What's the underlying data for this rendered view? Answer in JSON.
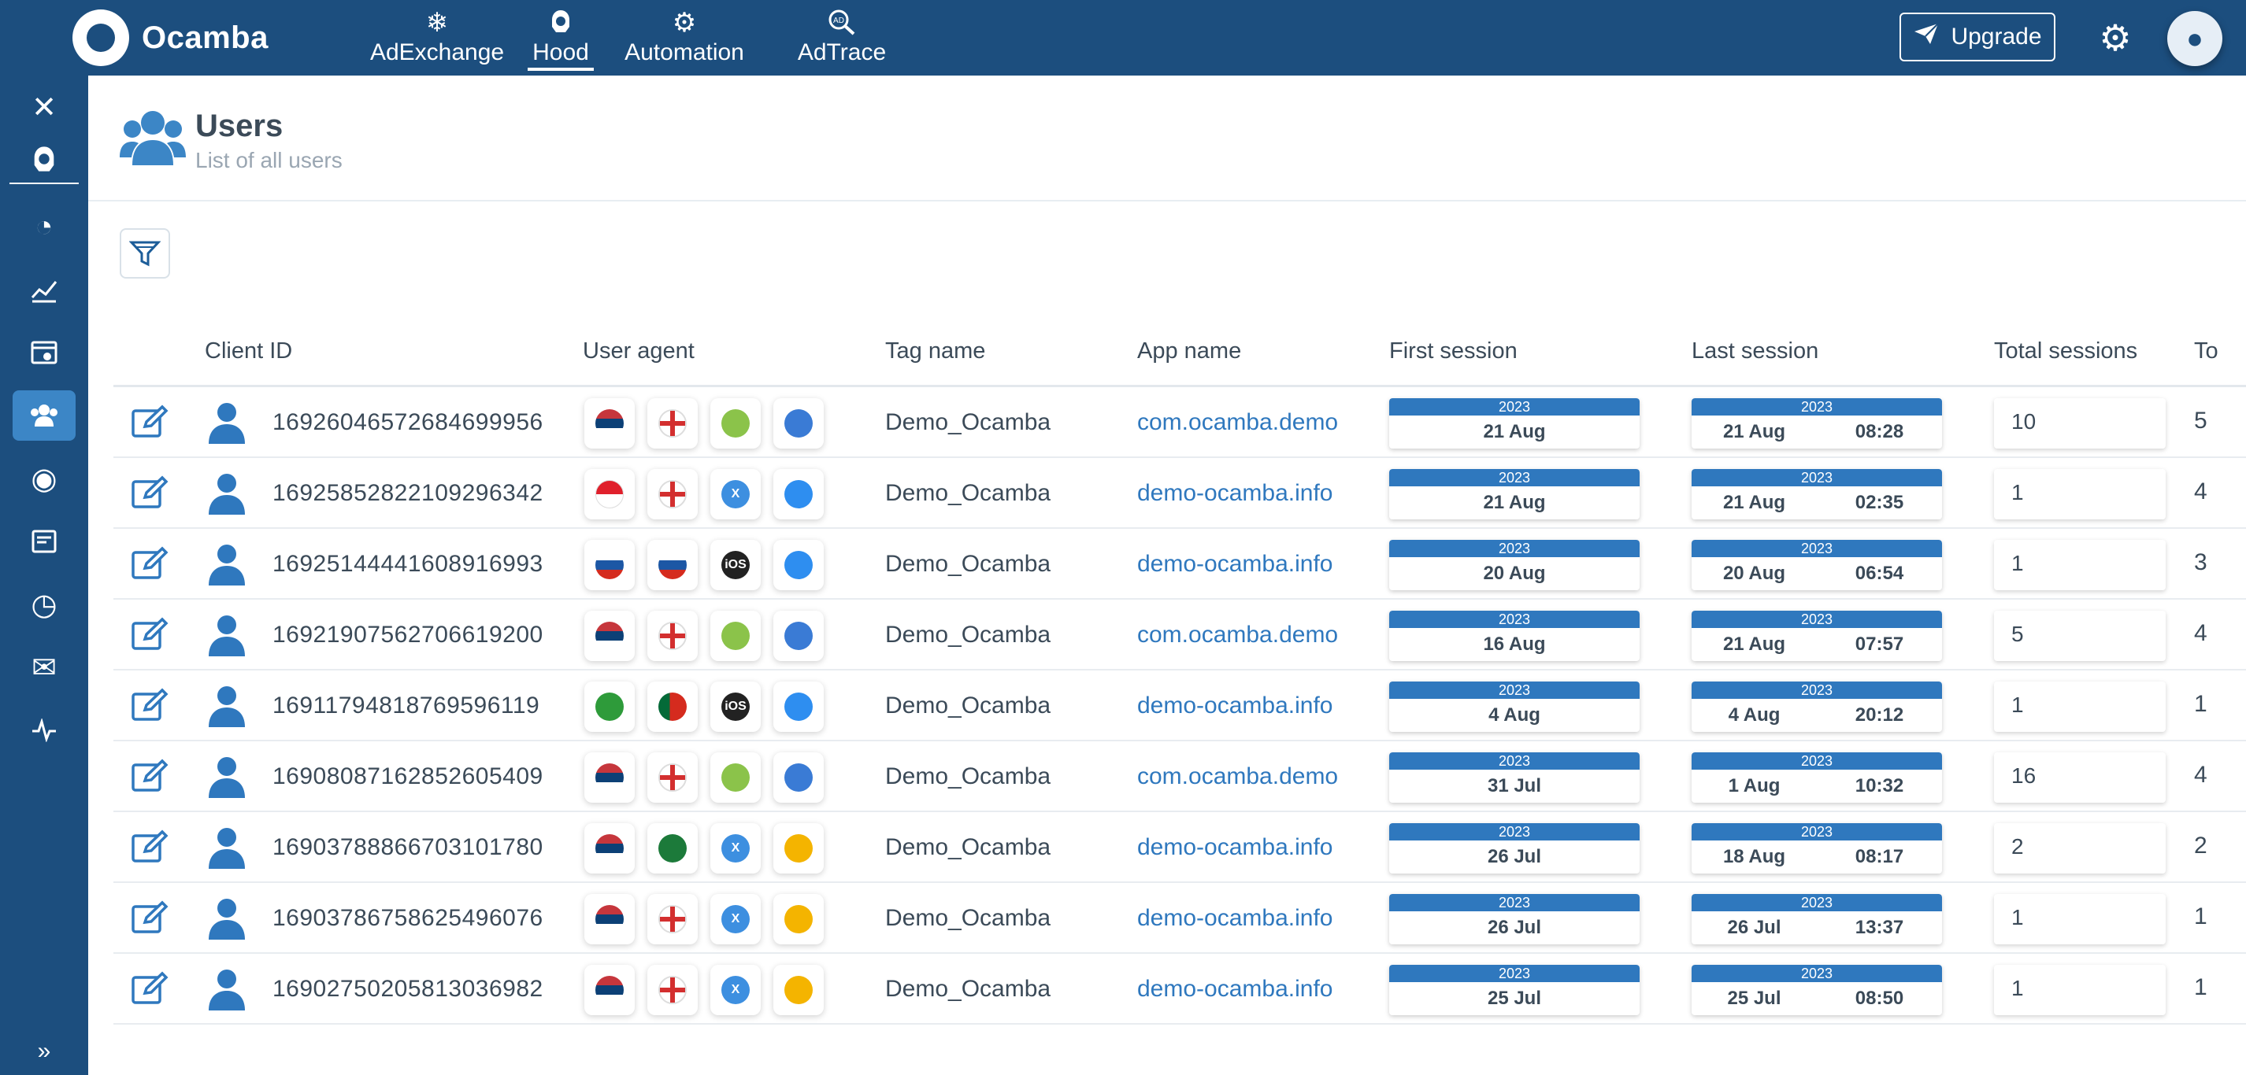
{
  "topbar": {
    "brand": "Ocamba",
    "nav": [
      {
        "label": "AdExchange",
        "icon": "snowflake-icon"
      },
      {
        "label": "Hood",
        "icon": "hood-icon"
      },
      {
        "label": "Automation",
        "icon": "automation-icon"
      },
      {
        "label": "AdTrace",
        "icon": "adtrace-icon"
      }
    ],
    "upgrade_label": "Upgrade"
  },
  "page": {
    "title": "Users",
    "subtitle": "List of all users"
  },
  "table": {
    "columns": [
      "Client ID",
      "User agent",
      "Tag name",
      "App name",
      "First session",
      "Last session",
      "Total sessions",
      "To"
    ],
    "rows": [
      {
        "client_id": "1692604657268469995​6",
        "ua": [
          "rs",
          "en",
          "android",
          "web"
        ],
        "tag": "Demo_Ocamba",
        "app": "com.ocamba.demo",
        "first_year": "2023",
        "first_date": "21 Aug",
        "last_year": "2023",
        "last_date": "21 Aug",
        "last_time": "08:28",
        "total": "10",
        "to": "5"
      },
      {
        "client_id": "16925852822109296342",
        "ua": [
          "id",
          "en",
          "ios-x",
          "safari"
        ],
        "tag": "Demo_Ocamba",
        "app": "demo-ocamba.info",
        "first_year": "2023",
        "first_date": "21 Aug",
        "last_year": "2023",
        "last_date": "21 Aug",
        "last_time": "02:35",
        "total": "1",
        "to": "4"
      },
      {
        "client_id": "16925144441608916993",
        "ua": [
          "ru",
          "ru",
          "ios",
          "safari"
        ],
        "tag": "Demo_Ocamba",
        "app": "demo-ocamba.info",
        "first_year": "2023",
        "first_date": "20 Aug",
        "last_year": "2023",
        "last_date": "20 Aug",
        "last_time": "06:54",
        "total": "1",
        "to": "3"
      },
      {
        "client_id": "16921907562706619200",
        "ua": [
          "rs",
          "en",
          "android",
          "web"
        ],
        "tag": "Demo_Ocamba",
        "app": "com.ocamba.demo",
        "first_year": "2023",
        "first_date": "16 Aug",
        "last_year": "2023",
        "last_date": "21 Aug",
        "last_time": "07:57",
        "total": "5",
        "to": "4"
      },
      {
        "client_id": "16911794818769596119",
        "ua": [
          "br",
          "pt",
          "ios",
          "safari"
        ],
        "tag": "Demo_Ocamba",
        "app": "demo-ocamba.info",
        "first_year": "2023",
        "first_date": "4 Aug",
        "last_year": "2023",
        "last_date": "4 Aug",
        "last_time": "20:12",
        "total": "1",
        "to": "1"
      },
      {
        "client_id": "16908087162852605409",
        "ua": [
          "rs",
          "en",
          "android",
          "web"
        ],
        "tag": "Demo_Ocamba",
        "app": "com.ocamba.demo",
        "first_year": "2023",
        "first_date": "31 Jul",
        "last_year": "2023",
        "last_date": "1 Aug",
        "last_time": "10:32",
        "total": "16",
        "to": "4"
      },
      {
        "client_id": "16903788866703101780",
        "ua": [
          "rs",
          "sa",
          "ios-x",
          "chrome"
        ],
        "tag": "Demo_Ocamba",
        "app": "demo-ocamba.info",
        "first_year": "2023",
        "first_date": "26 Jul",
        "last_year": "2023",
        "last_date": "18 Aug",
        "last_time": "08:17",
        "total": "2",
        "to": "2"
      },
      {
        "client_id": "16903786758625496076",
        "ua": [
          "rs",
          "en",
          "ios-x",
          "chrome"
        ],
        "tag": "Demo_Ocamba",
        "app": "demo-ocamba.info",
        "first_year": "2023",
        "first_date": "26 Jul",
        "last_year": "2023",
        "last_date": "26 Jul",
        "last_time": "13:37",
        "total": "1",
        "to": "1"
      },
      {
        "client_id": "16902750205813036982",
        "ua": [
          "rs",
          "en",
          "ios-x",
          "chrome"
        ],
        "tag": "Demo_Ocamba",
        "app": "demo-ocamba.info",
        "first_year": "2023",
        "first_date": "25 Jul",
        "last_year": "2023",
        "last_date": "25 Jul",
        "last_time": "08:50",
        "total": "1",
        "to": "1"
      }
    ]
  },
  "ua_styles": {
    "rs": {
      "bg": "#c6363c",
      "text": ""
    },
    "en": {
      "bg": "#ffffff",
      "text": ""
    },
    "id": {
      "bg": "#e0202c",
      "text": ""
    },
    "ru": {
      "bg": "#1c57a5",
      "text": ""
    },
    "br": {
      "bg": "#2e9b3a",
      "text": ""
    },
    "pt": {
      "bg": "#d52b1e",
      "text": ""
    },
    "sa": {
      "bg": "#1c7a3a",
      "text": ""
    },
    "android": {
      "bg": "#8bc34a",
      "text": ""
    },
    "ios": {
      "bg": "#222222",
      "text": "iOS"
    },
    "ios-x": {
      "bg": "#3d8fe0",
      "text": "X"
    },
    "web": {
      "bg": "#3a7bd5",
      "text": ""
    },
    "safari": {
      "bg": "#2e8ef0",
      "text": ""
    },
    "chrome": {
      "bg": "#f4b400",
      "text": ""
    }
  }
}
